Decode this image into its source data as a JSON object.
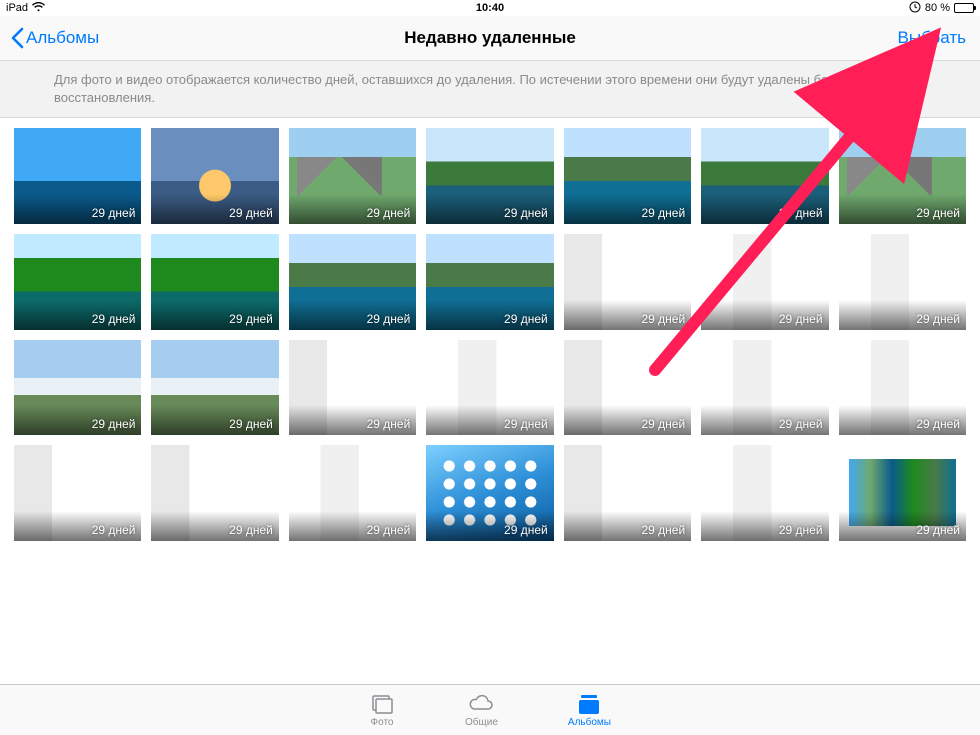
{
  "status": {
    "device": "iPad",
    "time": "10:40",
    "battery_pct": "80 %"
  },
  "nav": {
    "back_label": "Альбомы",
    "title": "Недавно удаленные",
    "select_label": "Выбрать"
  },
  "banner": {
    "text": "Для фото и видео отображается количество дней, оставшихся до удаления. По истечении этого времени они будут удалены без возможности восстановления."
  },
  "days_label": "29 дней",
  "thumbs": [
    {
      "bg": "bg-beach"
    },
    {
      "bg": "bg-pier"
    },
    {
      "bg": "bg-mtn"
    },
    {
      "bg": "bg-lake"
    },
    {
      "bg": "bg-lake2"
    },
    {
      "bg": "bg-lake"
    },
    {
      "bg": "bg-mtn"
    },
    {
      "bg": "bg-green"
    },
    {
      "bg": "bg-green"
    },
    {
      "bg": "bg-lake2"
    },
    {
      "bg": "bg-lake2"
    },
    {
      "bg": "bg-shot"
    },
    {
      "bg": "bg-shot2"
    },
    {
      "bg": "bg-shot2"
    },
    {
      "bg": "bg-snow"
    },
    {
      "bg": "bg-snow"
    },
    {
      "bg": "bg-shot"
    },
    {
      "bg": "bg-shot2"
    },
    {
      "bg": "bg-shot"
    },
    {
      "bg": "bg-shot2"
    },
    {
      "bg": "bg-shot2"
    },
    {
      "bg": "bg-shot"
    },
    {
      "bg": "bg-shot"
    },
    {
      "bg": "bg-shot2"
    },
    {
      "bg": "bg-home"
    },
    {
      "bg": "bg-shot"
    },
    {
      "bg": "bg-shot2"
    },
    {
      "bg": "bg-thumbs"
    }
  ],
  "tabs": {
    "photos": "Фото",
    "shared": "Общие",
    "albums": "Альбомы"
  }
}
